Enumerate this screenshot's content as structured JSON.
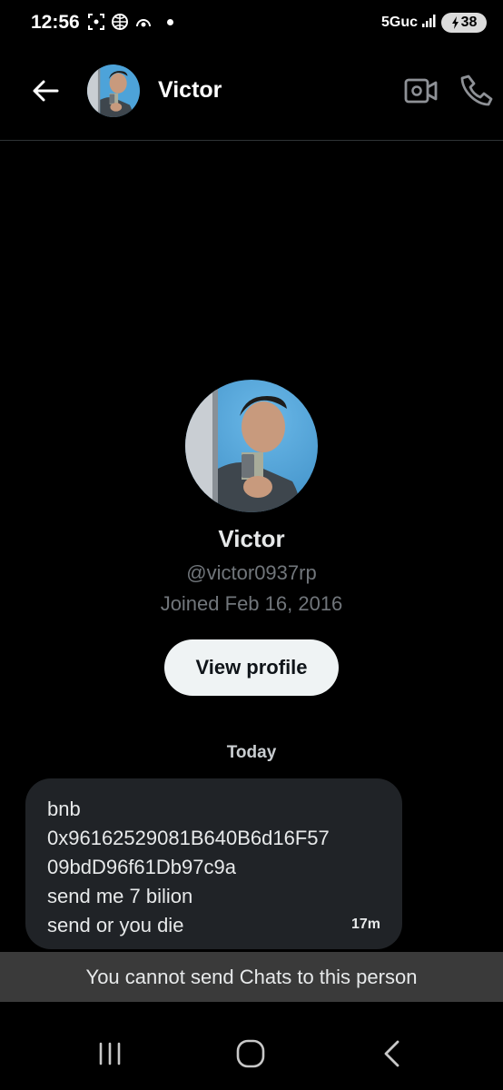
{
  "status_bar": {
    "time": "12:56",
    "icons": [
      "screenshot-icon",
      "ball-icon",
      "assistant-icon",
      "dot-icon"
    ],
    "network": "5Guc",
    "signal": "signal-icon",
    "battery": "38"
  },
  "header": {
    "name": "Victor",
    "back_icon": "arrow-left-icon",
    "video_icon": "video-camera-icon",
    "call_icon": "phone-icon"
  },
  "profile": {
    "name": "Victor",
    "handle": "@victor0937rp",
    "joined": "Joined Feb 16, 2016",
    "view_profile_label": "View profile"
  },
  "conversation": {
    "date_separator": "Today",
    "messages": [
      {
        "lines": [
          "bnb",
          "0x96162529081B640B6d16F57",
          "09bdD96f61Db97c9a",
          "send me 7 bilion",
          "send or you die"
        ],
        "time": "17m"
      }
    ]
  },
  "notice": "You cannot send Chats to this person",
  "colors": {
    "background": "#000000",
    "bubble": "#202327",
    "secondary_text": "#71767b",
    "notice_bar": "#3a3a3a"
  }
}
